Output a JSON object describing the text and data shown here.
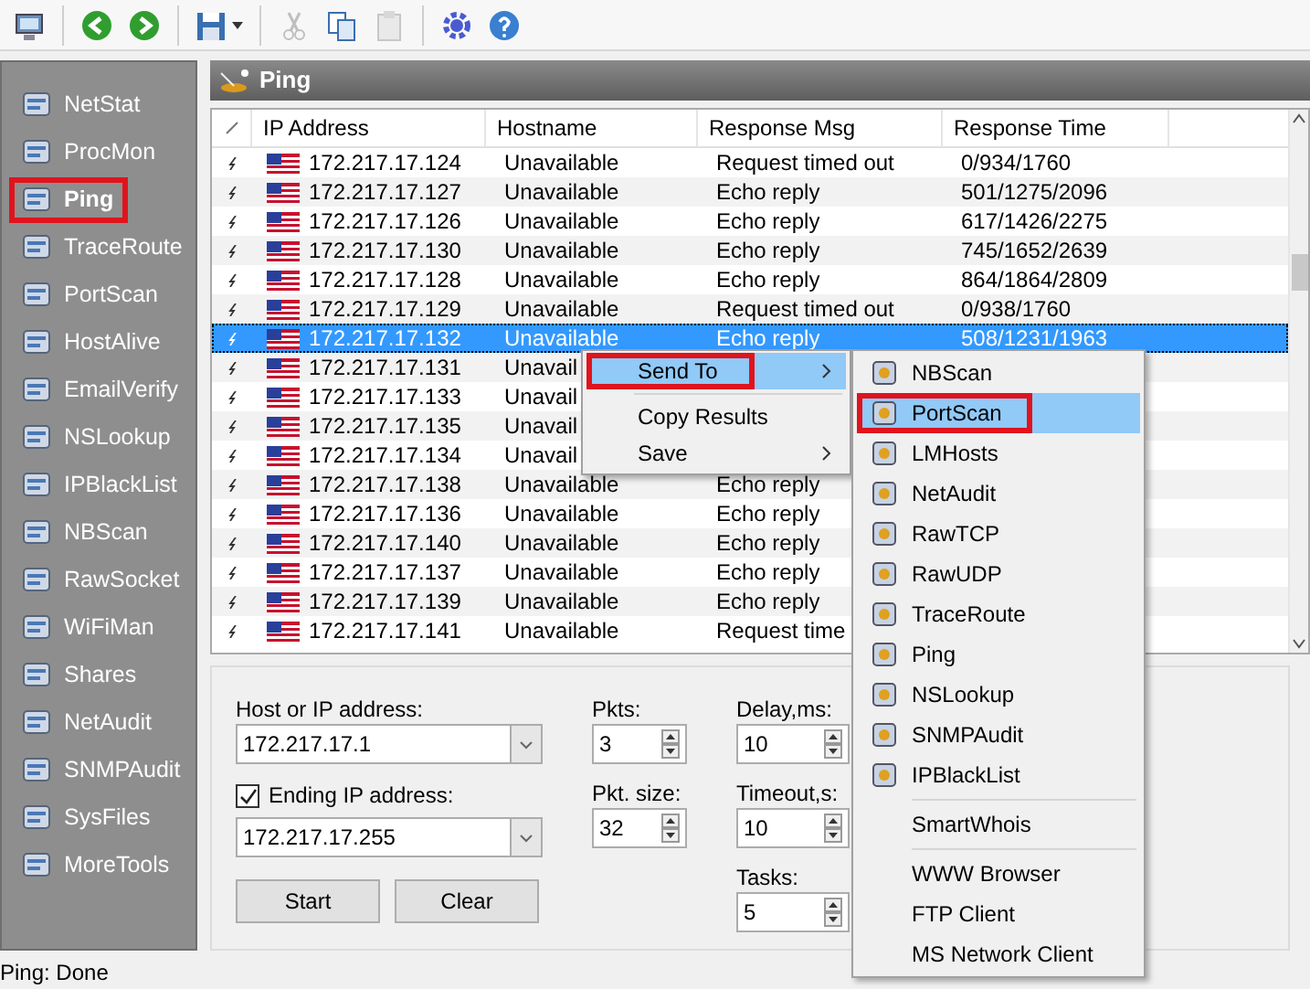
{
  "toolbar": {
    "buttons": [
      {
        "kind": "computer",
        "disabled": false
      },
      {
        "kind": "back",
        "disabled": false
      },
      {
        "kind": "forward",
        "disabled": false
      },
      {
        "kind": "save",
        "disabled": false
      },
      {
        "kind": "cut",
        "disabled": true
      },
      {
        "kind": "copy",
        "disabled": false
      },
      {
        "kind": "paste",
        "disabled": true
      },
      {
        "kind": "settings",
        "disabled": false
      },
      {
        "kind": "help",
        "disabled": false
      }
    ]
  },
  "sidebar": {
    "items": [
      {
        "label": "NetStat",
        "selected": false,
        "highlighted": false
      },
      {
        "label": "ProcMon",
        "selected": false,
        "highlighted": false
      },
      {
        "label": "Ping",
        "selected": true,
        "highlighted": true
      },
      {
        "label": "TraceRoute",
        "selected": false,
        "highlighted": false
      },
      {
        "label": "PortScan",
        "selected": false,
        "highlighted": false
      },
      {
        "label": "HostAlive",
        "selected": false,
        "highlighted": false
      },
      {
        "label": "EmailVerify",
        "selected": false,
        "highlighted": false
      },
      {
        "label": "NSLookup",
        "selected": false,
        "highlighted": false
      },
      {
        "label": "IPBlackList",
        "selected": false,
        "highlighted": false
      },
      {
        "label": "NBScan",
        "selected": false,
        "highlighted": false
      },
      {
        "label": "RawSocket",
        "selected": false,
        "highlighted": false
      },
      {
        "label": "WiFiMan",
        "selected": false,
        "highlighted": false
      },
      {
        "label": "Shares",
        "selected": false,
        "highlighted": false
      },
      {
        "label": "NetAudit",
        "selected": false,
        "highlighted": false
      },
      {
        "label": "SNMPAudit",
        "selected": false,
        "highlighted": false
      },
      {
        "label": "SysFiles",
        "selected": false,
        "highlighted": false
      },
      {
        "label": "MoreTools",
        "selected": false,
        "highlighted": false
      }
    ]
  },
  "panel": {
    "title": "Ping"
  },
  "table": {
    "columns": [
      "IP Address",
      "Hostname",
      "Response Msg",
      "Response Time"
    ],
    "rows": [
      {
        "ip": "172.217.17.124",
        "hostname": "Unavailable",
        "response_msg": "Request timed out",
        "response_time": "0/934/1760",
        "selected": false
      },
      {
        "ip": "172.217.17.127",
        "hostname": "Unavailable",
        "response_msg": "Echo reply",
        "response_time": "501/1275/2096",
        "selected": false
      },
      {
        "ip": "172.217.17.126",
        "hostname": "Unavailable",
        "response_msg": "Echo reply",
        "response_time": "617/1426/2275",
        "selected": false
      },
      {
        "ip": "172.217.17.130",
        "hostname": "Unavailable",
        "response_msg": "Echo reply",
        "response_time": "745/1652/2639",
        "selected": false
      },
      {
        "ip": "172.217.17.128",
        "hostname": "Unavailable",
        "response_msg": "Echo reply",
        "response_time": "864/1864/2809",
        "selected": false
      },
      {
        "ip": "172.217.17.129",
        "hostname": "Unavailable",
        "response_msg": "Request timed out",
        "response_time": "0/938/1760",
        "selected": false
      },
      {
        "ip": "172.217.17.132",
        "hostname": "Unavailable",
        "response_msg": "Echo reply",
        "response_time": "508/1231/1963",
        "selected": true
      },
      {
        "ip": "172.217.17.131",
        "hostname": "Unavail",
        "selected": false
      },
      {
        "ip": "172.217.17.133",
        "hostname": "Unavail",
        "selected": false
      },
      {
        "ip": "172.217.17.135",
        "hostname": "Unavail",
        "selected": false
      },
      {
        "ip": "172.217.17.134",
        "hostname": "Unavail",
        "selected": false
      },
      {
        "ip": "172.217.17.138",
        "hostname": "Unavailable",
        "response_msg": "Echo reply",
        "selected": false
      },
      {
        "ip": "172.217.17.136",
        "hostname": "Unavailable",
        "response_msg": "Echo reply",
        "selected": false
      },
      {
        "ip": "172.217.17.140",
        "hostname": "Unavailable",
        "response_msg": "Echo reply",
        "selected": false
      },
      {
        "ip": "172.217.17.137",
        "hostname": "Unavailable",
        "response_msg": "Echo reply",
        "selected": false
      },
      {
        "ip": "172.217.17.139",
        "hostname": "Unavailable",
        "response_msg": "Echo reply",
        "selected": false
      },
      {
        "ip": "172.217.17.141",
        "hostname": "Unavailable",
        "response_msg": "Request time",
        "selected": false
      }
    ]
  },
  "form": {
    "host_label": "Host or IP address:",
    "host_value": "172.217.17.1",
    "ending_checked": true,
    "ending_label": "Ending IP address:",
    "ending_value": "172.217.17.255",
    "buttons": [
      "Start",
      "Clear"
    ],
    "spinners": [
      {
        "label": "Pkts:",
        "value": "3"
      },
      {
        "label": "Pkt. size:",
        "value": "32"
      },
      {
        "label": "Delay,ms:",
        "value": "10"
      },
      {
        "label": "Timeout,s:",
        "value": "10"
      },
      {
        "label": "Tasks:",
        "value": "5"
      }
    ]
  },
  "context_menu": {
    "items": [
      {
        "label": "Send To",
        "submenu": true,
        "selected": true,
        "highlighted": true
      },
      {
        "kind": "separator"
      },
      {
        "label": "Copy Results",
        "submenu": false,
        "selected": false,
        "highlighted": false
      },
      {
        "label": "Save",
        "submenu": true,
        "selected": false,
        "highlighted": false
      }
    ]
  },
  "send_to_menu": {
    "items": [
      {
        "label": "NBScan",
        "icon": true,
        "selected": false,
        "highlighted": false
      },
      {
        "label": "PortScan",
        "icon": true,
        "selected": true,
        "highlighted": true
      },
      {
        "label": "LMHosts",
        "icon": true,
        "selected": false,
        "highlighted": false
      },
      {
        "label": "NetAudit",
        "icon": true,
        "selected": false,
        "highlighted": false
      },
      {
        "label": "RawTCP",
        "icon": true,
        "selected": false,
        "highlighted": false
      },
      {
        "label": "RawUDP",
        "icon": true,
        "selected": false,
        "highlighted": false
      },
      {
        "label": "TraceRoute",
        "icon": true,
        "selected": false,
        "highlighted": false
      },
      {
        "label": "Ping",
        "icon": true,
        "selected": false,
        "highlighted": false
      },
      {
        "label": "NSLookup",
        "icon": true,
        "selected": false,
        "highlighted": false
      },
      {
        "label": "SNMPAudit",
        "icon": true,
        "selected": false,
        "highlighted": false
      },
      {
        "label": "IPBlackList",
        "icon": true,
        "selected": false,
        "highlighted": false
      },
      {
        "kind": "separator"
      },
      {
        "label": "SmartWhois",
        "icon": false,
        "selected": false,
        "highlighted": false
      },
      {
        "kind": "separator"
      },
      {
        "label": "WWW Browser",
        "icon": false,
        "selected": false,
        "highlighted": false
      },
      {
        "label": "FTP Client",
        "icon": false,
        "selected": false,
        "highlighted": false
      },
      {
        "label": "MS Network Client",
        "icon": false,
        "selected": false,
        "highlighted": false
      }
    ]
  },
  "status_bar": {
    "text": "Ping: Done"
  }
}
